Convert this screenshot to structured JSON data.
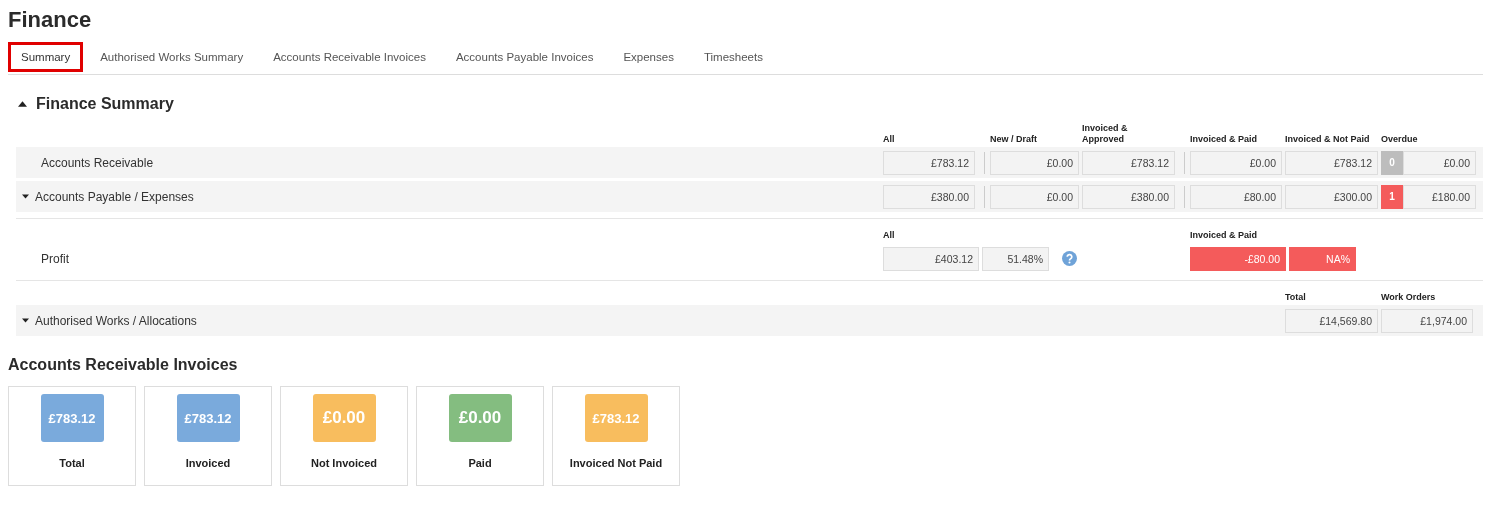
{
  "title": "Finance",
  "tabs": [
    {
      "label": "Summary",
      "selected": true
    },
    {
      "label": "Authorised Works Summary",
      "selected": false
    },
    {
      "label": "Accounts Receivable Invoices",
      "selected": false
    },
    {
      "label": "Accounts Payable Invoices",
      "selected": false
    },
    {
      "label": "Expenses",
      "selected": false
    },
    {
      "label": "Timesheets",
      "selected": false
    }
  ],
  "finance_summary": {
    "title": "Finance Summary",
    "expanded": true,
    "columns": [
      "All",
      "New / Draft",
      "Invoiced & Approved",
      "Invoiced & Paid",
      "Invoiced & Not Paid",
      "Overdue"
    ],
    "rows": [
      {
        "label": "Accounts Receivable",
        "expandable": false,
        "values": [
          "£783.12",
          "£0.00",
          "£783.12",
          "£0.00",
          "£783.12"
        ],
        "overdue_count": "0",
        "overdue": false,
        "overdue_value": "£0.00"
      },
      {
        "label": "Accounts Payable / Expenses",
        "expandable": true,
        "values": [
          "£380.00",
          "£0.00",
          "£380.00",
          "£80.00",
          "£300.00"
        ],
        "overdue_count": "1",
        "overdue": true,
        "overdue_value": "£180.00"
      }
    ],
    "profit": {
      "label": "Profit",
      "all_header": "All",
      "all": "£403.12",
      "all_percent": "51.48%",
      "paid_header": "Invoiced & Paid",
      "paid": "-£80.00",
      "paid_percent": "NA%",
      "paid_negative": true
    },
    "authorised": {
      "label": "Authorised Works / Allocations",
      "expandable": true,
      "columns": [
        "Total",
        "Work Orders"
      ],
      "values": [
        "£14,569.80",
        "£1,974.00"
      ]
    }
  },
  "invoices": {
    "title": "Accounts Receivable Invoices",
    "cards": [
      {
        "label": "Total",
        "value": "£783.12",
        "color": "#7aaadc"
      },
      {
        "label": "Invoiced",
        "value": "£783.12",
        "color": "#7aaadc"
      },
      {
        "label": "Not Invoiced",
        "value": "£0.00",
        "color": "#f8bd5e"
      },
      {
        "label": "Paid",
        "value": "£0.00",
        "color": "#84bd80"
      },
      {
        "label": "Invoiced Not Paid",
        "value": "£783.12",
        "color": "#f8bd5e"
      }
    ]
  }
}
